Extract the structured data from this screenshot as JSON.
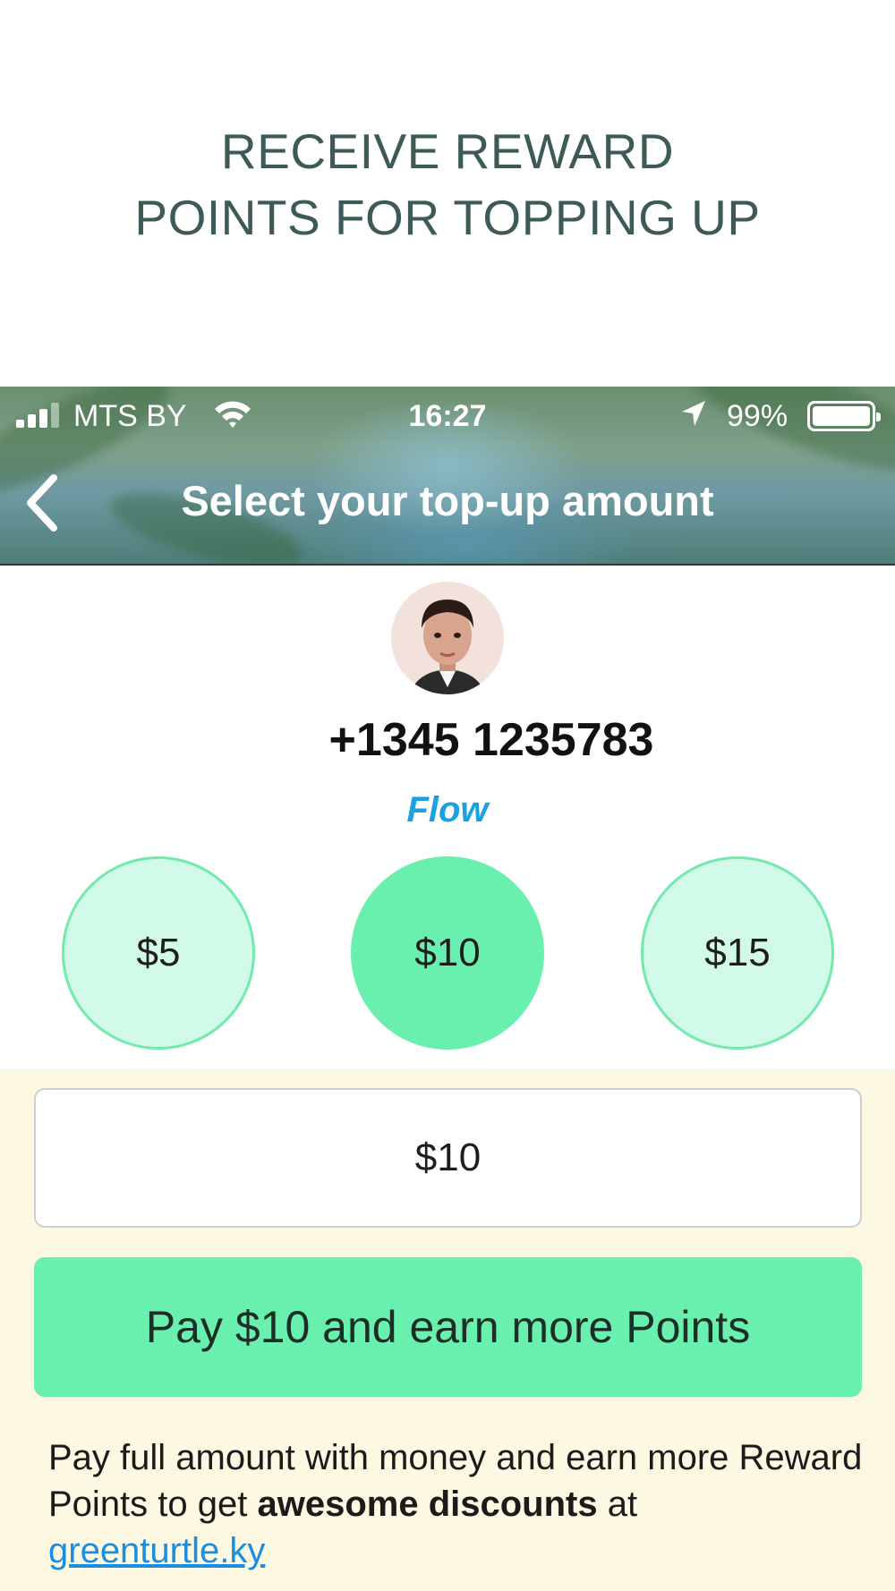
{
  "promo": {
    "line1": "RECEIVE REWARD",
    "line2": "POINTS FOR TOPPING UP"
  },
  "status_bar": {
    "carrier": "MTS BY",
    "time": "16:27",
    "battery": "99%",
    "icons": [
      "signal-icon",
      "wifi-icon",
      "location-arrow-icon",
      "battery-icon"
    ]
  },
  "nav": {
    "back_icon": "chevron-left-icon",
    "title": "Select your top-up amount"
  },
  "contact": {
    "phone": "+1345 1235783",
    "operator": "Flow"
  },
  "amounts": {
    "options": [
      "$5",
      "$10",
      "$15"
    ],
    "selected": "$10"
  },
  "amount_field": {
    "value": "$10"
  },
  "pay_button": {
    "label": "Pay $10 and earn more Points"
  },
  "info": {
    "text_before": "Pay full amount with money and earn more Reward Points to get ",
    "bold": "awesome discounts",
    "text_after": " at ",
    "link": "greenturtle.ky"
  },
  "colors": {
    "accent_green": "#69f0ae",
    "light_green": "#d2fae8",
    "operator_blue": "#1aa2e0",
    "panel_bg": "#fdf8e2",
    "heading": "#3d5a58"
  }
}
